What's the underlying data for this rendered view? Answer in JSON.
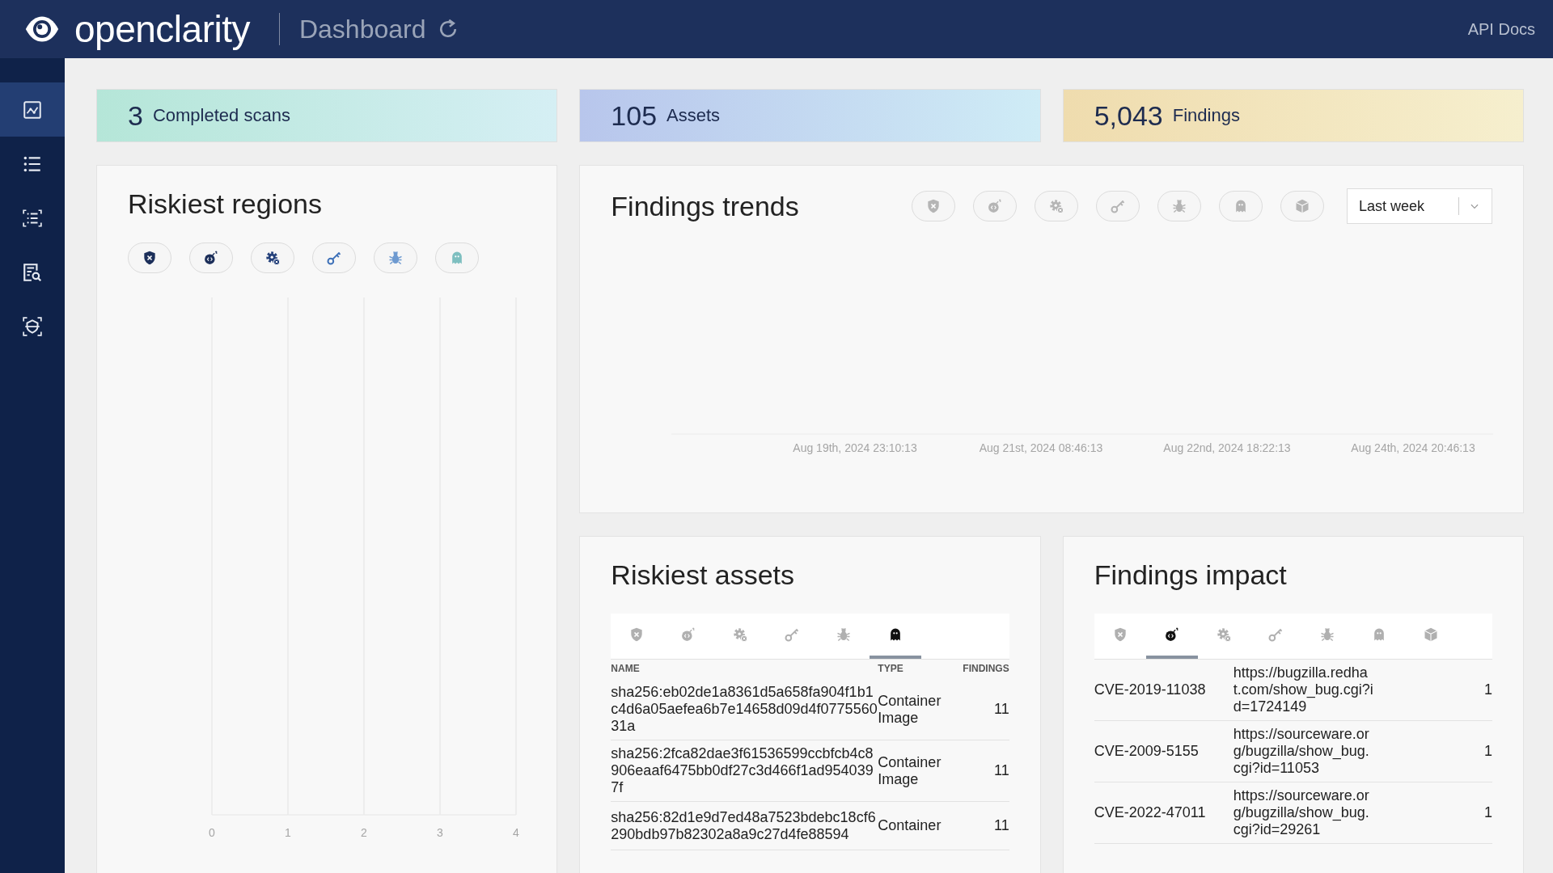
{
  "header": {
    "logo": "openclarity",
    "title": "Dashboard",
    "link": "API Docs"
  },
  "sidebar": {
    "items": [
      {
        "selected": true
      },
      {
        "selected": false
      },
      {
        "selected": false
      },
      {
        "selected": false
      },
      {
        "selected": false
      }
    ]
  },
  "stats": [
    {
      "kind": "scans",
      "value": "3",
      "label": "Completed scans"
    },
    {
      "kind": "assets",
      "value": "105",
      "label": "Assets"
    },
    {
      "kind": "findings",
      "value": "5,043",
      "label": "Findings"
    }
  ],
  "riskiest_regions": {
    "title": "Riskiest regions",
    "filters": [
      {
        "selected": true
      },
      {
        "selected": true
      },
      {
        "selected": true
      },
      {
        "selected": true
      },
      {
        "selected": true
      },
      {
        "selected": true
      }
    ],
    "axis_labels": [
      "0",
      "1",
      "2",
      "3",
      "4"
    ]
  },
  "findings_trends": {
    "title": "Findings trends",
    "filters": [
      {
        "selected": false
      },
      {
        "selected": false
      },
      {
        "selected": false
      },
      {
        "selected": false
      },
      {
        "selected": false
      },
      {
        "selected": false
      },
      {
        "selected": false
      }
    ],
    "range": {
      "value": "Last week"
    },
    "axis_labels": [
      "Aug 19th, 2024 23:10:13",
      "Aug 21st, 2024 08:46:13",
      "Aug 22nd, 2024 18:22:13",
      "Aug 24th, 2024 20:46:13"
    ]
  },
  "riskiest_assets": {
    "title": "Riskiest assets",
    "tabs": [
      {
        "selected": false
      },
      {
        "selected": false
      },
      {
        "selected": false
      },
      {
        "selected": false
      },
      {
        "selected": false
      },
      {
        "selected": true
      }
    ],
    "columns": [
      "NAME",
      "TYPE",
      "FINDINGS"
    ],
    "rows": [
      {
        "name": "sha256:eb02de1a8361d5a658fa904f1b1c4d6a05aefea6b7e14658d09d4f077556031a",
        "type": "Container Image",
        "findings": "11"
      },
      {
        "name": "sha256:2fca82dae3f61536599ccbfcb4c8906eaaf6475bb0df27c3d466f1ad9540397f",
        "type": "Container Image",
        "findings": "11"
      },
      {
        "name": "sha256:82d1e9d7ed48a7523bdebc18cf6290bdb97b82302a8a9c27d4fe88594",
        "type": "Container",
        "findings": "11"
      }
    ]
  },
  "findings_impact": {
    "title": "Findings impact",
    "tabs": [
      {
        "selected": false
      },
      {
        "selected": true
      },
      {
        "selected": false
      },
      {
        "selected": false
      },
      {
        "selected": false
      },
      {
        "selected": false
      },
      {
        "selected": false
      }
    ],
    "rows": [
      {
        "cve": "CVE-2019-11038",
        "link": "https://bugzilla.redhat.com/show_bug.cgi?id=1724149",
        "count": "1"
      },
      {
        "cve": "CVE-2009-5155",
        "link": "https://sourceware.org/bugzilla/show_bug.cgi?id=11053",
        "count": "1"
      },
      {
        "cve": "CVE-2022-47011",
        "link": "https://sourceware.org/bugzilla/show_bug.cgi?id=29261",
        "count": "1"
      }
    ]
  }
}
